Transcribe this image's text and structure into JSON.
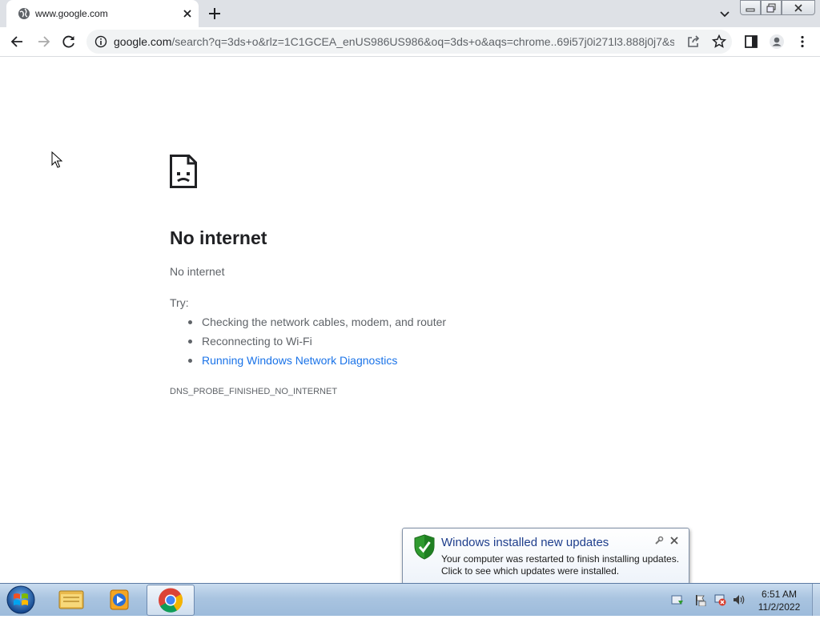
{
  "browser": {
    "tab_title": "www.google.com",
    "url_host": "google.com",
    "url_rest": "/search?q=3ds+o&rlz=1C1GCEA_enUS986US986&oq=3ds+o&aqs=chrome..69i57j0i271l3.888j0j7&s..."
  },
  "error": {
    "title": "No internet",
    "subtitle": "No internet",
    "try_label": "Try:",
    "suggestions": [
      "Checking the network cables, modem, and router",
      "Reconnecting to Wi-Fi",
      "Running Windows Network Diagnostics"
    ],
    "code": "DNS_PROBE_FINISHED_NO_INTERNET"
  },
  "notification": {
    "title": "Windows installed new updates",
    "line1": "Your computer was restarted to finish installing updates.",
    "line2": "Click to see which updates were installed."
  },
  "taskbar": {
    "time": "6:51 AM",
    "date": "11/2/2022"
  },
  "colors": {
    "link": "#1a73e8",
    "tabstrip": "#dee1e6",
    "error_text": "#5f6368",
    "notification_title": "#1e3e8c"
  },
  "icons": [
    "globe-icon",
    "close-icon",
    "plus-icon",
    "chevron-down-icon",
    "back-icon",
    "forward-icon",
    "reload-icon",
    "info-icon",
    "share-icon",
    "star-icon",
    "side-panel-icon",
    "profile-icon",
    "menu-icon",
    "sad-page-icon",
    "shield-check-icon",
    "windows-orb-icon",
    "folder-icon",
    "media-player-icon",
    "chrome-icon",
    "flag-icon",
    "network-icon",
    "volume-icon"
  ]
}
